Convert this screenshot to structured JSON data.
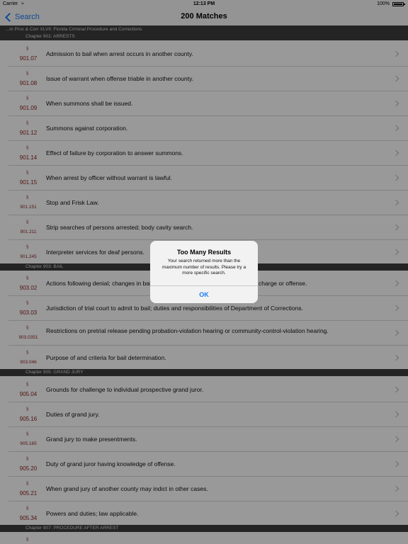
{
  "status_bar": {
    "carrier": "Carrier",
    "time": "12:13 PM",
    "battery": "100%"
  },
  "nav": {
    "back_label": "Search",
    "title": "200 Matches"
  },
  "breadcrumb": "...m Proc & Corr XLVII: Florida Criminal Procedure and Corrections",
  "section_symbol": "§",
  "sections": [
    {
      "header": "Chapter 901: ARRESTS"
    },
    {
      "header": "Chapter 903: BAIL"
    },
    {
      "header": "Chapter 905: GRAND JURY"
    },
    {
      "header": "Chapter 907: PROCEDURE AFTER ARREST"
    }
  ],
  "rows": [
    {
      "number": "901.07",
      "title": "Admission to bail when arrest occurs in another county."
    },
    {
      "number": "901.08",
      "title": "Issue of warrant when offense triable in another county."
    },
    {
      "number": "901.09",
      "title": "When summons shall be issued."
    },
    {
      "number": "901.12",
      "title": "Summons against corporation."
    },
    {
      "number": "901.14",
      "title": "Effect of failure by corporation to answer summons."
    },
    {
      "number": "901.15",
      "title": "When arrest by officer without warrant is lawful."
    },
    {
      "number": "901.151",
      "title": "Stop and Frisk Law."
    },
    {
      "number": "901.211",
      "title": "Strip searches of persons arrested; body cavity search."
    },
    {
      "number": "901.245",
      "title": "Interpreter services for deaf persons."
    },
    {
      "number": "903.02",
      "title": "Actions following denial; changes in bail; determination of release conditions by charge or offense."
    },
    {
      "number": "903.03",
      "title": "Jurisdiction of trial court to admit to bail; duties and responsibilities of Department of Corrections."
    },
    {
      "number": "903.0351",
      "title": "Restrictions on pretrial release pending probation-violation hearing or community-control-violation hearing."
    },
    {
      "number": "903.046",
      "title": "Purpose of and criteria for bail determination."
    },
    {
      "number": "905.04",
      "title": "Grounds for challenge to individual prospective grand juror."
    },
    {
      "number": "905.16",
      "title": "Duties of grand jury."
    },
    {
      "number": "905.165",
      "title": "Grand jury to make presentments."
    },
    {
      "number": "905.20",
      "title": "Duty of grand juror having knowledge of offense."
    },
    {
      "number": "905.21",
      "title": "When grand jury of another county may indict in other cases."
    },
    {
      "number": "905.34",
      "title": "Powers and duties; law applicable."
    }
  ],
  "alert": {
    "title": "Too Many Results",
    "message": "Your search returned more than the maximum number of results. Please try a more specific search.",
    "ok_label": "OK"
  },
  "colors": {
    "accent": "#1a7cf5",
    "section_number": "#8a1f1f",
    "header_bg": "#3c3c3c"
  }
}
